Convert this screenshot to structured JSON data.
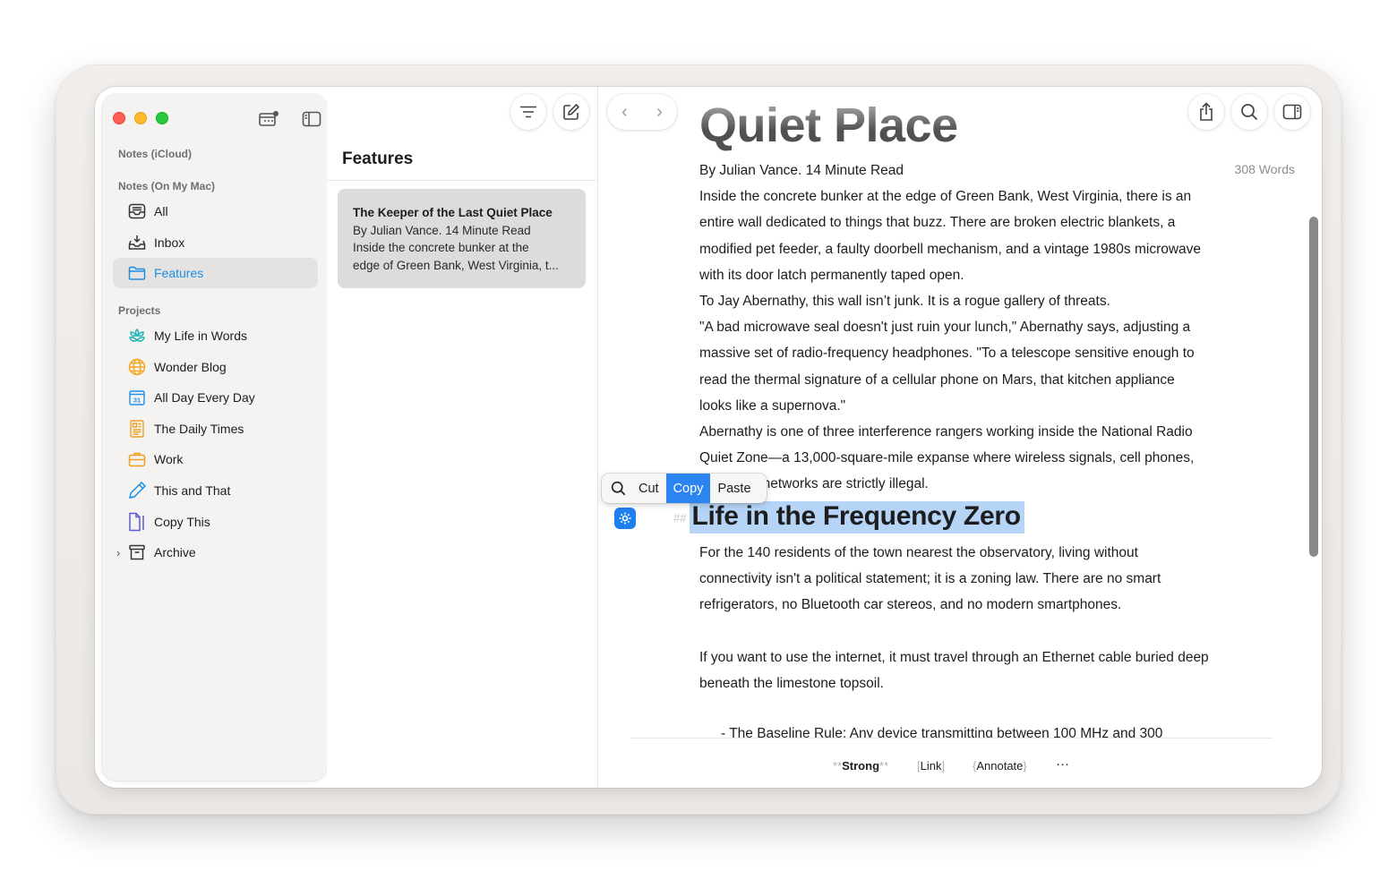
{
  "sidebar": {
    "section_icloud": "Notes (iCloud)",
    "section_mac": "Notes (On My Mac)",
    "items": [
      {
        "label": "All",
        "icon": "tray-icon"
      },
      {
        "label": "Inbox",
        "icon": "inbox-icon"
      },
      {
        "label": "Features",
        "icon": "folder-icon"
      }
    ],
    "projects_label": "Projects",
    "projects": [
      {
        "label": "My Life in Words",
        "icon": "flower-icon"
      },
      {
        "label": "Wonder Blog",
        "icon": "globe-icon"
      },
      {
        "label": "All Day Every Day",
        "icon": "calendar-icon"
      },
      {
        "label": "The Daily Times",
        "icon": "newspaper-icon"
      },
      {
        "label": "Work",
        "icon": "briefcase-icon"
      },
      {
        "label": "This and That",
        "icon": "pencil-icon"
      },
      {
        "label": "Copy This",
        "icon": "document-icon"
      },
      {
        "label": "Archive",
        "icon": "archive-icon"
      }
    ]
  },
  "list": {
    "title": "Features",
    "note": {
      "title": "The Keeper of the Last Quiet Place",
      "line1": "By Julian Vance. 14 Minute Read",
      "line2": "Inside the concrete bunker at the",
      "line3": "edge of Green Bank, West Virginia, t..."
    }
  },
  "editor": {
    "title": "Quiet Place",
    "word_count": "308 Words",
    "paragraphs": [
      "By Julian Vance. 14 Minute Read",
      "Inside the concrete bunker at the edge of Green Bank, West Virginia, there is an entire wall dedicated to things that buzz. There are broken electric blankets, a modified pet feeder, a faulty doorbell mechanism, and a vintage 1980s microwave with its door latch permanently taped open.",
      "To Jay Abernathy, this wall isn’t junk. It is a rogue gallery of threats.",
      "\"A bad microwave seal doesn't just ruin your lunch,\" Abernathy says, adjusting a massive set of radio-frequency headphones. \"To a telescope sensitive enough to read the thermal signature of a cellular phone on Mars, that kitchen appliance looks like a supernova.\"",
      "Abernathy is one of three interference rangers working inside the National Radio Quiet Zone—a 13,000-square-mile expanse where wireless signals, cell phones, and Wi-Fi networks are strictly illegal."
    ],
    "heading_marker": "##",
    "heading": "Life in the Frequency Zero",
    "paragraphs2": [
      "For the 140 residents of the town nearest the observatory, living without connectivity isn't a political statement; it is a zoning law. There are no smart refrigerators, no Bluetooth car stereos, and no modern smartphones.",
      "",
      "If you want to use the internet, it must travel through an Ethernet cable buried deep beneath the limestone topsoil."
    ],
    "cutoff_line": "- The Baseline Rule: Any device transmitting between 100 MHz and 300",
    "format_bar": {
      "strong_open": "**",
      "strong": "Strong",
      "strong_close": "**",
      "link_open": "[",
      "link": "Link",
      "link_close": "]",
      "annotate_open": "{",
      "annotate": "Annotate",
      "annotate_close": "}",
      "more": "···"
    }
  },
  "context_menu": {
    "cut": "Cut",
    "copy": "Copy",
    "paste": "Paste"
  },
  "colors": {
    "accent": "#1a8fe3",
    "selection": "#b5d4f6",
    "copy_highlight": "#2b84f0"
  }
}
